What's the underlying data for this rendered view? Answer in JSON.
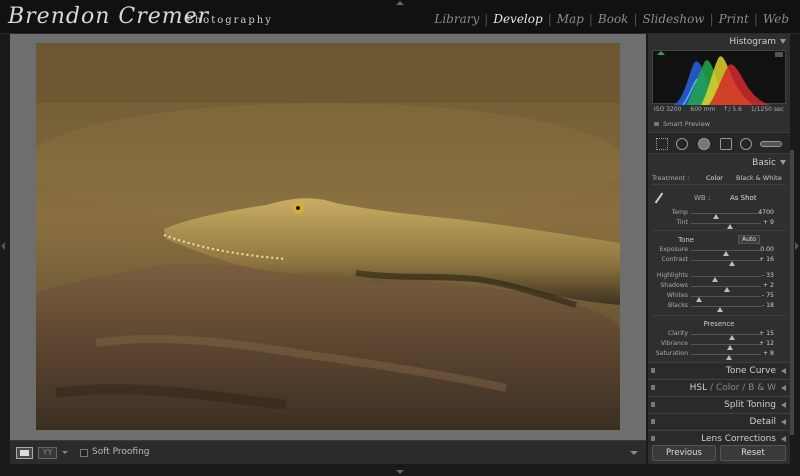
{
  "brand": {
    "name": "Brendon Cremer",
    "sub": "Photography"
  },
  "modules": [
    {
      "label": "Library",
      "active": false
    },
    {
      "label": "Develop",
      "active": true
    },
    {
      "label": "Map",
      "active": false
    },
    {
      "label": "Book",
      "active": false
    },
    {
      "label": "Slideshow",
      "active": false
    },
    {
      "label": "Print",
      "active": false
    },
    {
      "label": "Web",
      "active": false
    }
  ],
  "histogram": {
    "title": "Histogram",
    "iso": "ISO 3200",
    "focal": "600 mm",
    "aperture": "f / 5.6",
    "shutter": "1/1250 sec",
    "smart_preview": "Smart Preview"
  },
  "basic": {
    "title": "Basic",
    "treatment_label": "Treatment :",
    "treatment_color": "Color",
    "treatment_bw": "Black & White",
    "wb_label": "WB :",
    "wb_value": "As Shot",
    "tone_label": "Tone",
    "auto_label": "Auto",
    "presence_label": "Presence",
    "wb_sliders": [
      {
        "label": "Temp",
        "value": "4700",
        "pos": 0.35
      },
      {
        "label": "Tint",
        "value": "+ 9",
        "pos": 0.56
      }
    ],
    "tone_sliders": [
      {
        "label": "Exposure",
        "value": "0.00",
        "pos": 0.5
      },
      {
        "label": "Contrast",
        "value": "+ 16",
        "pos": 0.58
      }
    ],
    "tone_sliders2": [
      {
        "label": "Highlights",
        "value": "- 33",
        "pos": 0.34
      },
      {
        "label": "Shadows",
        "value": "+ 2",
        "pos": 0.51
      },
      {
        "label": "Whites",
        "value": "- 75",
        "pos": 0.12
      },
      {
        "label": "Blacks",
        "value": "- 18",
        "pos": 0.41
      }
    ],
    "presence_sliders": [
      {
        "label": "Clarity",
        "value": "+ 15",
        "pos": 0.58
      },
      {
        "label": "Vibrance",
        "value": "+ 12",
        "pos": 0.56
      },
      {
        "label": "Saturation",
        "value": "+ 8",
        "pos": 0.54
      }
    ]
  },
  "panels": {
    "tone_curve": "Tone Curve",
    "hsl": "HSL",
    "color": "Color",
    "bw": "B & W",
    "split_toning": "Split Toning",
    "detail": "Detail",
    "lens_corrections": "Lens Corrections"
  },
  "toolbar": {
    "soft_proofing": "Soft Proofing",
    "yy": "YY"
  },
  "buttons": {
    "previous": "Previous",
    "reset": "Reset"
  },
  "colors": {
    "accent": "#e8e8e8",
    "panel": "#2f2f2f",
    "canvas": "#6e6e6e"
  }
}
